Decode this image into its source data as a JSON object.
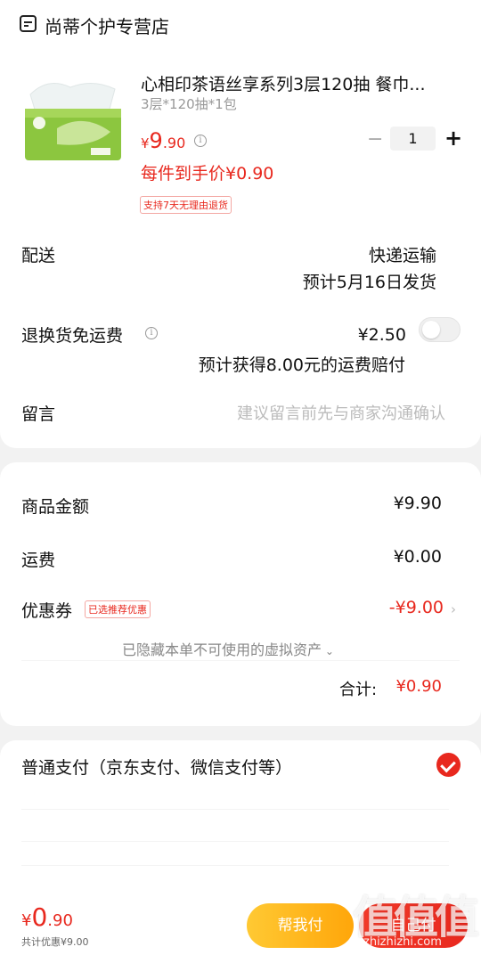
{
  "store": {
    "name": "尚蒂个护专营店",
    "icon": "store-icon"
  },
  "product": {
    "title": "心相印茶语丝享系列3层120抽 餐巾...",
    "spec": "3层*120抽*1包",
    "price_currency": "¥",
    "price_int": "9",
    "price_dec": ".90",
    "quantity": "1",
    "minus": "−",
    "plus": "+",
    "hand_price": "每件到手价¥0.90",
    "return_tag": "支持7天无理由退货"
  },
  "delivery": {
    "label": "配送",
    "method": "快递运输",
    "eta": "预计5月16日发货"
  },
  "return_shipping": {
    "label": "退换货免运费",
    "price": "¥2.50",
    "note": "预计获得8.00元的运费赔付",
    "enabled": false
  },
  "message": {
    "label": "留言",
    "placeholder": "建议留言前先与商家沟通确认"
  },
  "summary": {
    "goods_label": "商品金额",
    "goods_value": "¥9.90",
    "shipping_label": "运费",
    "shipping_value": "¥0.00",
    "coupon_label": "优惠券",
    "coupon_tag": "已选推荐优惠",
    "coupon_value": "-¥9.00",
    "hidden_note": "已隐藏本单不可使用的虚拟资产",
    "total_label": "合计:",
    "total_value": "¥0.90"
  },
  "payment": {
    "label": "普通支付（京东支付、微信支付等）",
    "selected": true
  },
  "footer": {
    "total_currency": "¥",
    "total_int": "0",
    "total_dec": ".90",
    "discount_note": "共计优惠¥9.00",
    "help_pay": "帮我付",
    "self_pay": "自己付"
  },
  "watermark": {
    "text": "值值值",
    "url": "zhizhizhi.com"
  },
  "colors": {
    "accent": "#e8281e",
    "yellow": "#ffb21c",
    "background": "#f2f2f2"
  }
}
